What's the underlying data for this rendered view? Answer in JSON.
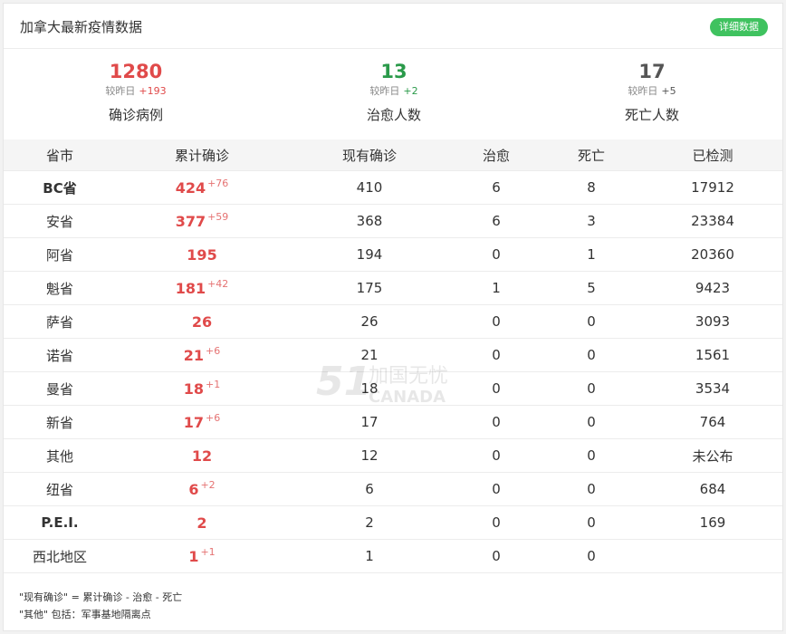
{
  "header": {
    "title": "加拿大最新疫情数据",
    "detail_button": "详细数据"
  },
  "summary": [
    {
      "value": "1280",
      "delta_prefix": "较昨日",
      "delta": "+193",
      "label": "确诊病例",
      "color": "#e04a4a"
    },
    {
      "value": "13",
      "delta_prefix": "较昨日",
      "delta": "+2",
      "label": "治愈人数",
      "color": "#2a9a4a"
    },
    {
      "value": "17",
      "delta_prefix": "较昨日",
      "delta": "+5",
      "label": "死亡人数",
      "color": "#555555"
    }
  ],
  "table": {
    "headers": [
      "省市",
      "累计确诊",
      "现有确诊",
      "治愈",
      "死亡",
      "已检测"
    ],
    "rows": [
      {
        "province": "BC省",
        "bold": true,
        "total": "424",
        "increase": "+76",
        "current": "410",
        "recovered": "6",
        "deaths": "8",
        "tested": "17912"
      },
      {
        "province": "安省",
        "bold": false,
        "total": "377",
        "increase": "+59",
        "current": "368",
        "recovered": "6",
        "deaths": "3",
        "tested": "23384"
      },
      {
        "province": "阿省",
        "bold": false,
        "total": "195",
        "increase": "",
        "current": "194",
        "recovered": "0",
        "deaths": "1",
        "tested": "20360"
      },
      {
        "province": "魁省",
        "bold": false,
        "total": "181",
        "increase": "+42",
        "current": "175",
        "recovered": "1",
        "deaths": "5",
        "tested": "9423"
      },
      {
        "province": "萨省",
        "bold": false,
        "total": "26",
        "increase": "",
        "current": "26",
        "recovered": "0",
        "deaths": "0",
        "tested": "3093"
      },
      {
        "province": "诺省",
        "bold": false,
        "total": "21",
        "increase": "+6",
        "current": "21",
        "recovered": "0",
        "deaths": "0",
        "tested": "1561"
      },
      {
        "province": "曼省",
        "bold": false,
        "total": "18",
        "increase": "+1",
        "current": "18",
        "recovered": "0",
        "deaths": "0",
        "tested": "3534"
      },
      {
        "province": "新省",
        "bold": false,
        "total": "17",
        "increase": "+6",
        "current": "17",
        "recovered": "0",
        "deaths": "0",
        "tested": "764"
      },
      {
        "province": "其他",
        "bold": false,
        "total": "12",
        "increase": "",
        "current": "12",
        "recovered": "0",
        "deaths": "0",
        "tested": "未公布"
      },
      {
        "province": "纽省",
        "bold": false,
        "total": "6",
        "increase": "+2",
        "current": "6",
        "recovered": "0",
        "deaths": "0",
        "tested": "684"
      },
      {
        "province": "P.E.I.",
        "bold": true,
        "total": "2",
        "increase": "",
        "current": "2",
        "recovered": "0",
        "deaths": "0",
        "tested": "169"
      },
      {
        "province": "西北地区",
        "bold": false,
        "total": "1",
        "increase": "+1",
        "current": "1",
        "recovered": "0",
        "deaths": "0",
        "tested": ""
      }
    ]
  },
  "footer": {
    "note1": "\"现有确诊\" = 累计确诊 - 治愈 - 死亡",
    "note2": "\"其他\" 包括：军事基地隔离点"
  },
  "watermark": {
    "number": "51",
    "text_cn": "加国无忧",
    "text_en": "CANADA"
  },
  "colors": {
    "accent_green": "#3fc25f",
    "confirmed_red": "#e04a4a",
    "recovered_green": "#2a9a4a"
  }
}
